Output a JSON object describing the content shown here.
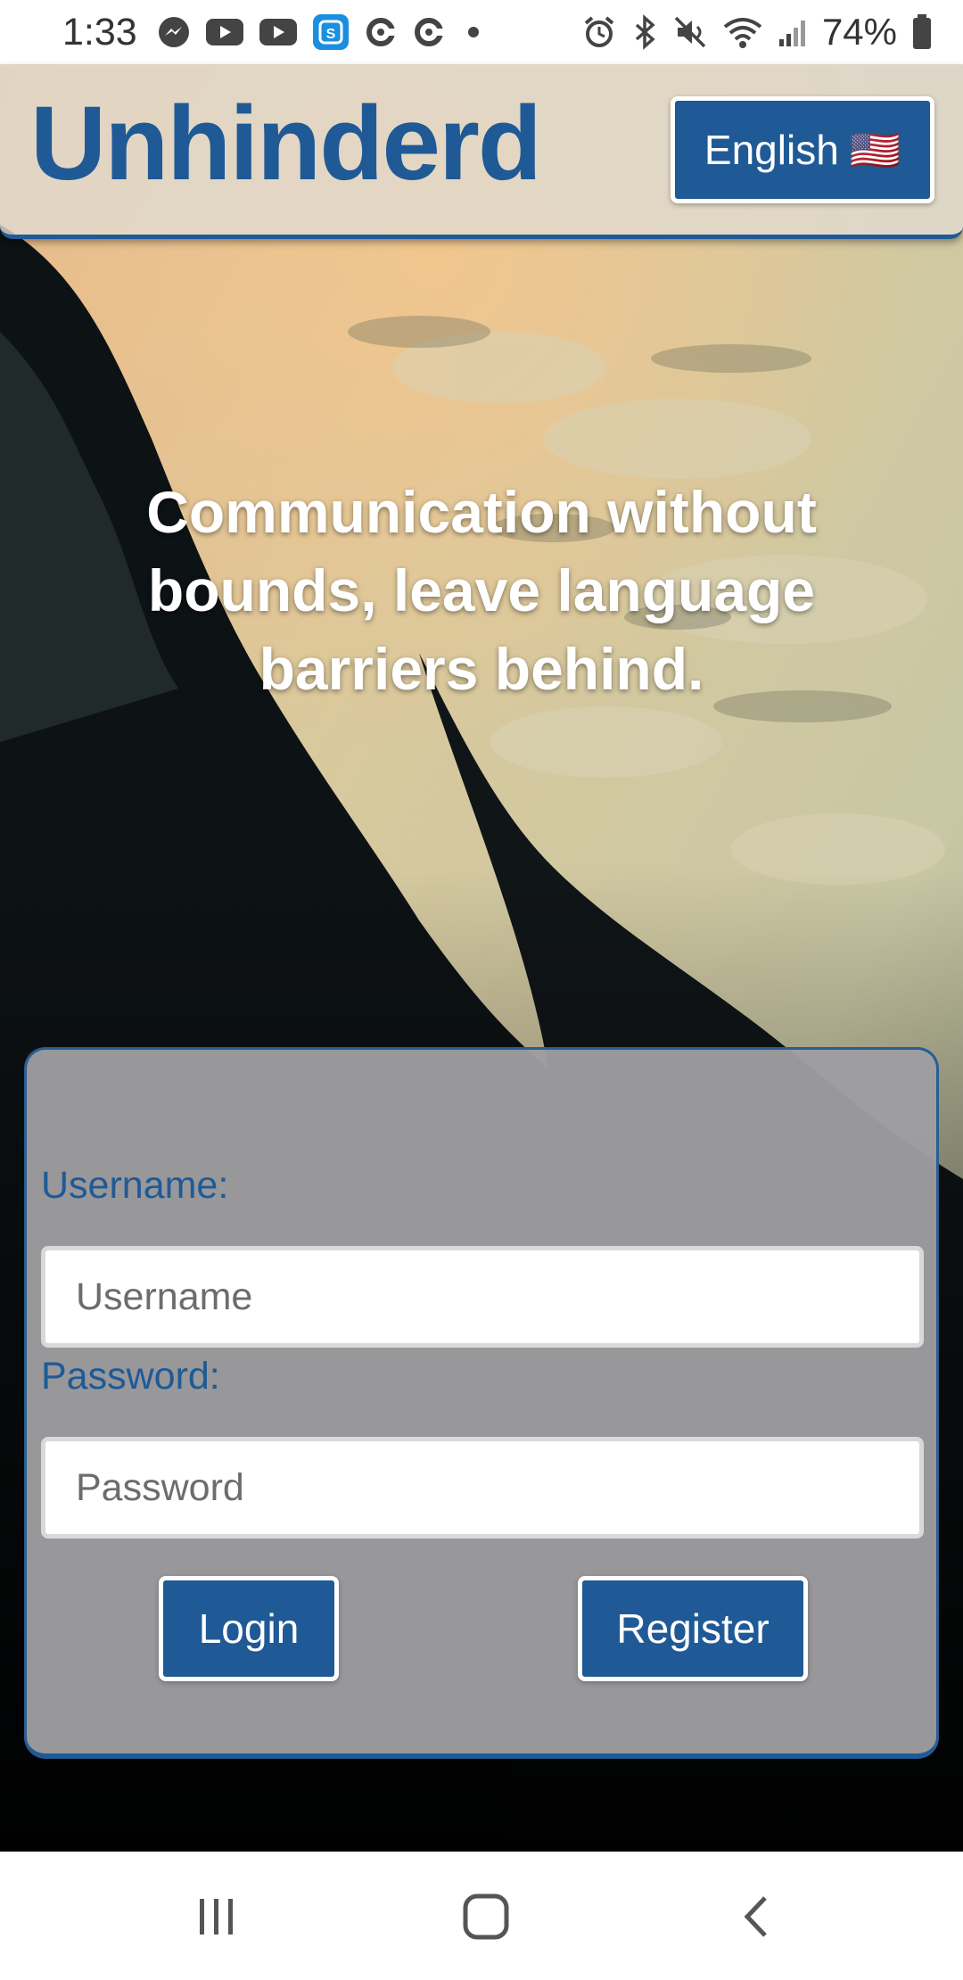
{
  "status_bar": {
    "time": "1:33",
    "battery_percent": "74%",
    "left_icons": [
      "messenger-icon",
      "youtube-icon",
      "youtube-icon",
      "s-app-icon",
      "c-app-icon",
      "c-app-icon",
      "dot-icon"
    ],
    "right_icons": [
      "alarm-icon",
      "bluetooth-icon",
      "mute-icon",
      "wifi-icon",
      "signal-icon",
      "battery-icon"
    ]
  },
  "header": {
    "brand": "Unhinderd",
    "language_button": "English",
    "language_flag": "🇺🇸"
  },
  "hero": {
    "tagline": "Communication without bounds, leave language barriers behind."
  },
  "login_form": {
    "username_label": "Username:",
    "username_placeholder": "Username",
    "password_label": "Password:",
    "password_placeholder": "Password",
    "login_button": "Login",
    "register_button": "Register"
  },
  "nav_bar": {
    "icons": [
      "recents-icon",
      "home-icon",
      "back-icon"
    ]
  },
  "colors": {
    "brand_blue": "#1f5a96",
    "card_gray": "#9e9da0",
    "header_tint": "#e0dad0"
  }
}
